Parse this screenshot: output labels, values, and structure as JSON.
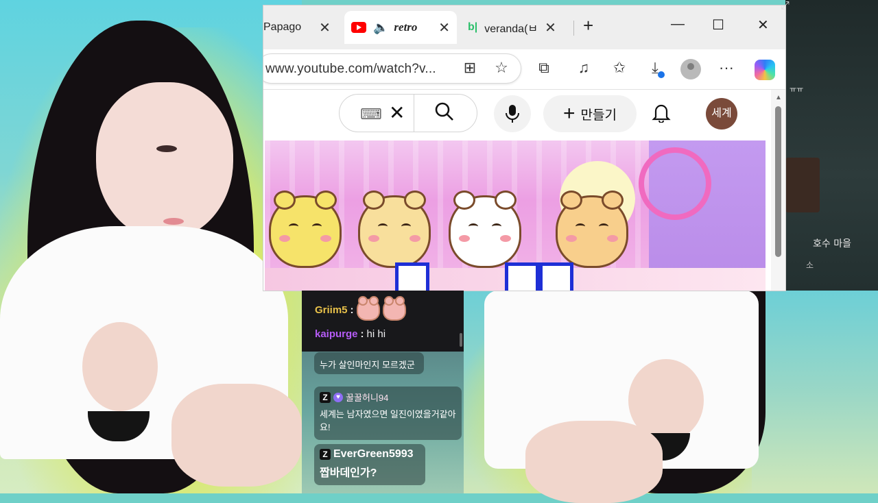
{
  "browser": {
    "tabs": [
      {
        "label": "Papago",
        "close": "✕"
      },
      {
        "label": "retro",
        "close": "✕",
        "active": true,
        "icon": "youtube-icon",
        "speaker": "🔈"
      },
      {
        "label": "veranda(ㅂ",
        "close": "✕",
        "favicon": "b|"
      }
    ],
    "new_tab": "+",
    "window_controls": {
      "minimize": "—",
      "maximize": "☐",
      "close": "✕"
    },
    "address": "www.youtube.com/watch?v...",
    "toolbar_icons": [
      "split-screen-icon",
      "favorite-star-icon",
      "extensions-icon",
      "media-control-icon",
      "favorites-icon",
      "downloads-icon",
      "profile-icon",
      "more-icon",
      "copilot-icon"
    ],
    "more": "···"
  },
  "youtube": {
    "keyboard_icon": "⌨",
    "clear": "✕",
    "search_icon": "⌕",
    "mic_icon": "🎤",
    "create_plus": "+",
    "create_label": "만들기",
    "bell_icon": "🔔",
    "avatar_label": "세계"
  },
  "game": {
    "label_top": "ㅠㅠ",
    "location": "호수 마을",
    "sub": "소"
  },
  "chat": {
    "dark": [
      {
        "user": "Griim5",
        "sep": ":",
        "emotes": 2
      },
      {
        "user": "kaipurge",
        "sep": ":",
        "message": "hi hi"
      }
    ],
    "bubbles": [
      {
        "message": "누가 살인마인지 모르겠군"
      },
      {
        "user": "꿀꿀허니94",
        "message": "세계는 남자였으면 일진이였을거같아요!"
      },
      {
        "user": "EverGreen5993",
        "message": "짭바데인가?"
      }
    ],
    "badge": "Z",
    "heart": "♥"
  },
  "resize_icon": "⤢",
  "colors": {
    "accent_youtube": "#ff0000",
    "chat_bg": "#18181b",
    "griim_color": "#e8c14a",
    "kaipurge_color": "#b55cf6"
  }
}
